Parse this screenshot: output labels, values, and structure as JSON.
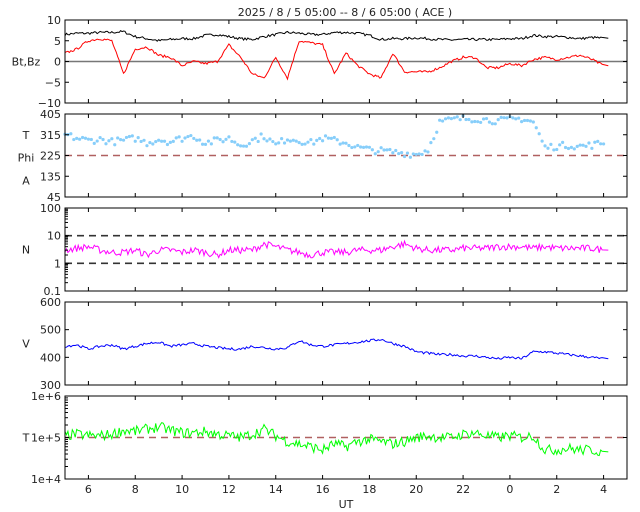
{
  "chart_data": {
    "type": "line",
    "title": "2025 /  8 /  5   05:00 -- 8 /  6   05:00 ( ACE )",
    "xlabel": "UT",
    "x_unit": "hours since 2025-08-05 05:00",
    "xlim": [
      0,
      24
    ],
    "x_step": 0.5,
    "x_ticks": [
      1,
      3,
      5,
      7,
      9,
      11,
      13,
      15,
      17,
      19,
      21,
      23
    ],
    "x_tick_labels": [
      "6",
      "8",
      "10",
      "12",
      "14",
      "16",
      "18",
      "20",
      "22",
      "0",
      "2",
      "4"
    ],
    "panels": [
      {
        "ylabel_lines": [
          "Bt,Bz"
        ],
        "scale": "linear",
        "ylim": [
          -10,
          10
        ],
        "y_ticks": [
          10,
          5,
          0,
          -5,
          -10
        ],
        "y_tick_labels": [
          "10",
          "5",
          "0",
          "−5",
          "−10"
        ],
        "reference_lines": [
          {
            "value": 0,
            "color": "#777777",
            "style": "solid"
          }
        ],
        "series": [
          {
            "name": "Bt",
            "color": "#000000",
            "mode": "line",
            "values": [
              6.5,
              6.8,
              6.8,
              7,
              7,
              7.2,
              6,
              5.5,
              5,
              5.3,
              5.5,
              5.5,
              6.3,
              6.5,
              6,
              5.5,
              5.3,
              6,
              6.5,
              7,
              6.8,
              6.5,
              6.5,
              7,
              7,
              6.8,
              6.3,
              5.3,
              5.5,
              5.5,
              5.7,
              5.5,
              5.3,
              5.2,
              5.3,
              5.3,
              5.3,
              5.3,
              5.5,
              5.5,
              6.3,
              6,
              6,
              5.8,
              5.5,
              5.8,
              5.6
            ]
          },
          {
            "name": "Bz",
            "color": "#ff0000",
            "mode": "line",
            "values": [
              2,
              3,
              5,
              5.5,
              5,
              -3,
              3,
              3.5,
              1.5,
              1,
              -1,
              0,
              -0.5,
              0,
              4,
              1,
              -3,
              -4,
              1,
              -4,
              5,
              4.5,
              4,
              -3,
              2,
              -1,
              -3,
              -4,
              2,
              -2.5,
              -2.5,
              -2.5,
              -1.5,
              0,
              1,
              1,
              -1.5,
              -1.5,
              -0.5,
              -1,
              0.5,
              1,
              0.5,
              1,
              1.5,
              0.5,
              -1
            ]
          }
        ]
      },
      {
        "ylabel_lines": [
          "T",
          "Phi",
          "A"
        ],
        "scale": "linear",
        "ylim": [
          45,
          405
        ],
        "y_ticks": [
          405,
          315,
          225,
          135,
          45
        ],
        "y_tick_labels": [
          "405",
          "315",
          "225",
          "135",
          "45"
        ],
        "reference_lines": [
          {
            "value": 225,
            "color": "#b06060",
            "style": "dashed"
          }
        ],
        "series": [
          {
            "name": "Phi",
            "color": "#87cefa",
            "mode": "scatter",
            "values": [
              315,
              300,
              290,
              295,
              285,
              290,
              300,
              280,
              295,
              285,
              300,
              310,
              280,
              290,
              300,
              270,
              290,
              310,
              270,
              300,
              290,
              280,
              300,
              290,
              280,
              260,
              250,
              245,
              240,
              235,
              230,
              250,
              370,
              380,
              385,
              385,
              380,
              375,
              380,
              385,
              370,
              260,
              265,
              270,
              265,
              270,
              280
            ]
          }
        ]
      },
      {
        "ylabel_lines": [
          "N"
        ],
        "scale": "log",
        "ylim": [
          0.1,
          100
        ],
        "y_ticks": [
          100,
          10,
          1,
          0.1
        ],
        "y_tick_labels": [
          "100",
          "10",
          "1",
          "0.1"
        ],
        "reference_lines": [
          {
            "value": 10,
            "color": "#333333",
            "style": "dashed"
          },
          {
            "value": 1,
            "color": "#333333",
            "style": "dashed"
          }
        ],
        "series": [
          {
            "name": "N",
            "color": "#ff00ff",
            "mode": "line",
            "values": [
              3,
              3.5,
              4,
              3,
              2.5,
              2.5,
              3,
              2,
              3,
              3,
              2.5,
              3,
              2.5,
              2,
              3,
              3,
              3,
              5,
              4,
              3,
              2.5,
              2,
              2.5,
              2.5,
              2.5,
              3,
              3,
              3,
              4,
              5,
              3.5,
              3,
              3,
              3,
              3.5,
              3.5,
              3.5,
              4,
              4,
              4,
              3.5,
              4,
              3.5,
              3.5,
              3.5,
              3.5,
              3
            ]
          }
        ]
      },
      {
        "ylabel_lines": [
          "V"
        ],
        "scale": "linear",
        "ylim": [
          300,
          600
        ],
        "y_ticks": [
          600,
          500,
          400,
          300
        ],
        "y_tick_labels": [
          "600",
          "500",
          "400",
          "300"
        ],
        "reference_lines": [],
        "series": [
          {
            "name": "V",
            "color": "#0000ff",
            "mode": "line",
            "values": [
              440,
              445,
              430,
              440,
              445,
              430,
              440,
              450,
              455,
              440,
              445,
              450,
              440,
              435,
              430,
              430,
              440,
              435,
              430,
              435,
              460,
              445,
              440,
              445,
              450,
              455,
              460,
              465,
              450,
              440,
              420,
              415,
              410,
              410,
              405,
              405,
              400,
              395,
              400,
              395,
              420,
              420,
              415,
              410,
              405,
              400,
              395
            ]
          }
        ]
      },
      {
        "ylabel_lines": [
          "T"
        ],
        "scale": "log",
        "ylim": [
          10000,
          1000000
        ],
        "y_ticks": [
          1000000,
          100000,
          10000
        ],
        "y_tick_labels": [
          "1e+6",
          "1e+5",
          "1e+4"
        ],
        "reference_lines": [
          {
            "value": 100000,
            "color": "#b06060",
            "style": "dashed"
          }
        ],
        "series": [
          {
            "name": "T",
            "color": "#00ff00",
            "mode": "line",
            "values": [
              110000,
              120000,
              110000,
              110000,
              120000,
              150000,
              140000,
              160000,
              180000,
              150000,
              130000,
              130000,
              140000,
              120000,
              110000,
              100000,
              120000,
              160000,
              110000,
              80000,
              70000,
              60000,
              50000,
              70000,
              60000,
              80000,
              90000,
              80000,
              70000,
              80000,
              100000,
              110000,
              100000,
              100000,
              120000,
              130000,
              110000,
              100000,
              110000,
              100000,
              110000,
              50000,
              50000,
              55000,
              50000,
              50000,
              45000
            ]
          }
        ]
      }
    ]
  }
}
